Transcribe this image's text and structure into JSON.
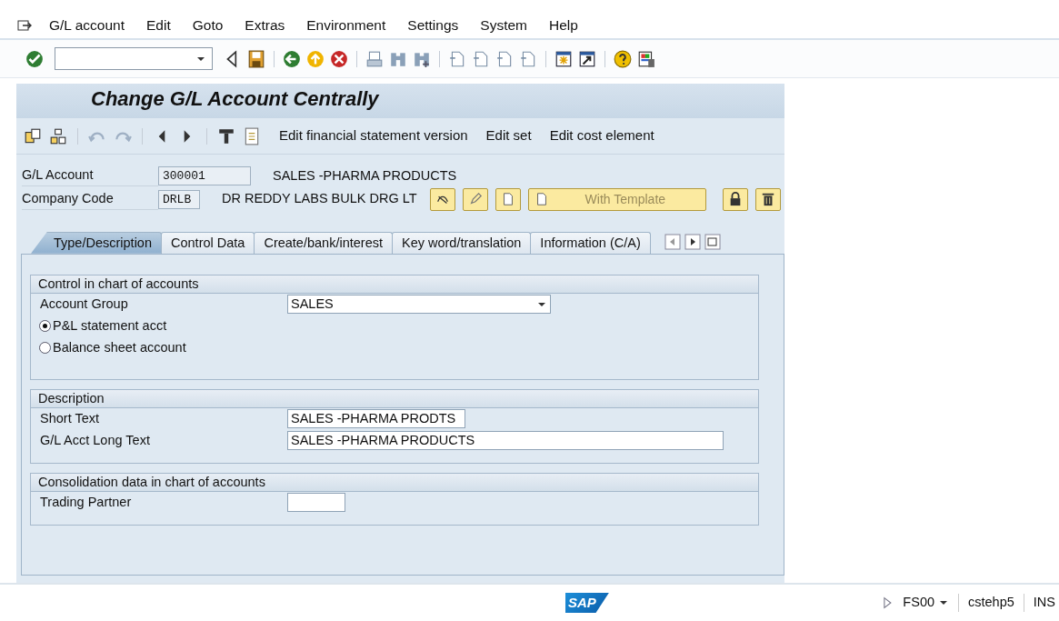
{
  "menu_bar": {
    "items": [
      "G/L account",
      "Edit",
      "Goto",
      "Extras",
      "Environment",
      "Settings",
      "System",
      "Help"
    ]
  },
  "title": "Change G/L Account Centrally",
  "app_toolbar": {
    "buttons": [
      "Edit financial statement version",
      "Edit set",
      "Edit cost element"
    ]
  },
  "header": {
    "fields": [
      {
        "label": "G/L Account",
        "value": "300001",
        "description": "SALES -PHARMA PRODUCTS"
      },
      {
        "label": "Company Code",
        "value": "DRLB",
        "description": "DR REDDY LABS BULK DRG LT"
      }
    ],
    "template_button": "With Template"
  },
  "tabs": [
    {
      "label": "Type/Description",
      "selected": true
    },
    {
      "label": "Control Data",
      "selected": false
    },
    {
      "label": "Create/bank/interest",
      "selected": false
    },
    {
      "label": "Key word/translation",
      "selected": false
    },
    {
      "label": "Information (C/A)",
      "selected": false
    }
  ],
  "groups": [
    {
      "title": "Control in chart of accounts",
      "rows": [
        {
          "kind": "dropdown",
          "label": "Account Group",
          "value": "SALES"
        },
        {
          "kind": "radio",
          "label": "P&L statement acct",
          "selected": true
        },
        {
          "kind": "radio",
          "label": "Balance sheet account",
          "selected": false
        }
      ]
    },
    {
      "title": "Description",
      "rows": [
        {
          "kind": "text",
          "label": "Short Text",
          "value": "SALES -PHARMA PRODTS"
        },
        {
          "kind": "text",
          "label": "G/L Acct Long Text",
          "value": "SALES -PHARMA PRODUCTS"
        }
      ]
    },
    {
      "title": "Consolidation data in chart of accounts",
      "rows": [
        {
          "kind": "text",
          "label": "Trading Partner",
          "value": ""
        }
      ]
    }
  ],
  "status_bar": {
    "logo": "SAP",
    "transaction": "FS00",
    "server": "cstehp5",
    "mode": "INS"
  }
}
